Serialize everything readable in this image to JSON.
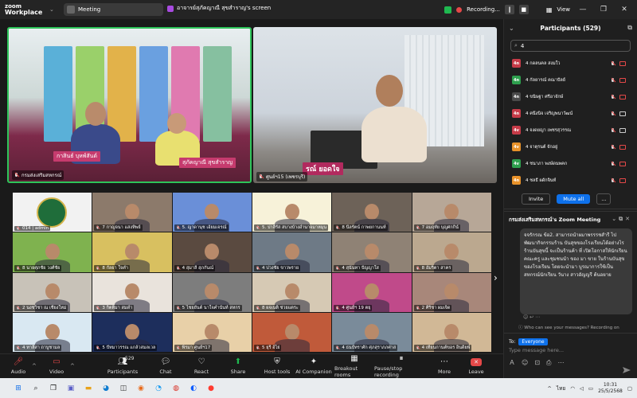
{
  "app": {
    "logo_line1": "zoom",
    "logo_line2": "Workplace",
    "meeting_label": "Meeting",
    "screen_share_label": "อาจารย์สุภัคญาณี สุขสำราญ's screen",
    "recording_label": "Recording...",
    "view_label": "View"
  },
  "spotlight": [
    {
      "name": "กรมส่งเสริมสหกรณ์",
      "nameplate_left": "กาสินธ์ บุหพ์สันต์",
      "nameplate_right": "สุภัคญาณี สุขสำราญ"
    },
    {
      "name": "ศูนย์ฯ15 (เพชรบุรี)",
      "nameplate_left": "รณ์ ยอดใจ"
    }
  ],
  "gallery": [
    {
      "name": "014 | admin",
      "color": "#f2f2f2"
    },
    {
      "name": "7 กาญจนา แสงทิพย์",
      "color": "#8c7a6b"
    },
    {
      "name": "5. ญาดานุช เอ้ยมเจรณ์",
      "color": "#6a8fd8"
    },
    {
      "name": "5. ปาลีรัส สบางบ้างอำนาจมาหมุน",
      "color": "#f7f2d9"
    },
    {
      "name": "8 นีลรัตน์ กาพยกานนท์",
      "color": "#6d6258"
    },
    {
      "name": "7 อมฤทัย บุญศกกิน์",
      "color": "#b7a797"
    },
    {
      "name": "8 นายศุภชัย วงศ์ชัย",
      "color": "#7fb24f"
    },
    {
      "name": "8 กัลยา ใจคำ",
      "color": "#d8c060"
    },
    {
      "name": "4 สุมาลี สุภกันณ์",
      "color": "#5a4a40"
    },
    {
      "name": "4 ปวงชัย ขาวพราย",
      "color": "#6e7a86"
    },
    {
      "name": "4 สุนันทา ปัญญาใส",
      "color": "#8f8275"
    },
    {
      "name": "8 อัมริตา สาคร",
      "color": "#bba88f"
    },
    {
      "name": "2 นงชวิชา ณ เชียงใหม่",
      "color": "#c8c2b8"
    },
    {
      "name": "3 กิตติมา สมดำ",
      "color": "#e9e3dc"
    },
    {
      "name": "5 ไชยยันต์ นาใจคำนันท์ สหกร",
      "color": "#7d7d7d"
    },
    {
      "name": "8 ผจเนติ ช่วยแตระ",
      "color": "#d6c9b4"
    },
    {
      "name": "4 ศูนย์ฯ 19 ตยุ",
      "color": "#c04a8a"
    },
    {
      "name": "2 ศิริชา ผมเจิด",
      "color": "#a8877a"
    },
    {
      "name": "4 ทาลีสา ถาบูชามล",
      "color": "#d9e8f2"
    },
    {
      "name": "5 ปัทมาวรรณ แกล้วสมลเวล",
      "color": "#1d2e5c"
    },
    {
      "name": "พิรมา ศูนย์ฯ17",
      "color": "#e8d0a8"
    },
    {
      "name": "5 ยุรี อ้ไย่",
      "color": "#c05a3a"
    },
    {
      "name": "4 ธนบัทราศัก ศุภสุราภภศาส",
      "color": "#7a8b9a"
    },
    {
      "name": "4 เทียนกานต์ขอร อินดิยพ์",
      "color": "#d1b896"
    }
  ],
  "toolbar": {
    "audio": "Audio",
    "video": "Video",
    "participants": "Participants",
    "participants_count": "529",
    "chat": "Chat",
    "react": "React",
    "share": "Share",
    "host_tools": "Host tools",
    "ai_companion": "AI Companion",
    "breakout": "Breakout rooms",
    "pause_rec": "Pause/stop recording",
    "more": "More",
    "leave": "Leave"
  },
  "participants": {
    "title": "Participants (529)",
    "search_value": "4",
    "list": [
      {
        "avatar": "4n",
        "name": "4 กดลนคล สงมใว",
        "color": "#c63b48",
        "cam": "off"
      },
      {
        "avatar": "4n",
        "name": "4 กัลยารณ์ คณาปัลย์",
        "color": "#2ea04e",
        "cam": "off"
      },
      {
        "avatar": "4n",
        "name": "4 ขนิษฐา ศรีอาจักษ์",
        "color": "#4a4a4a",
        "cam": "off"
      },
      {
        "avatar": "4n",
        "name": "4 คนึงนิจ เจริญพนาวัฒน์",
        "color": "#c63b48",
        "cam": "on"
      },
      {
        "avatar": "4v",
        "name": "4 จงดยญา เพชรสุวรรณ",
        "color": "#c63b48",
        "cam": "on"
      },
      {
        "avatar": "4v",
        "name": "4 จาตุรนต์ จักอยู่",
        "color": "#e8922a",
        "cam": "off"
      },
      {
        "avatar": "4v",
        "name": "4 ชนาภา พงษ์ดนพคก",
        "color": "#2ea04e",
        "cam": "off"
      },
      {
        "avatar": "4n",
        "name": "4 ชลธี ผดักจินท์",
        "color": "#e8922a",
        "cam": "off"
      }
    ],
    "invite": "Invite",
    "mute_all": "Mute all",
    "more": "..."
  },
  "chat": {
    "title": "กรมส่งเสริมสหกรณ์'s Zoom Meeting",
    "message": "จจรักรณ ข้อ2. สามารถนำผมาพรรรชสำรี ไปพัฒนากิจกรรมร้าน บันสุขของโรงเรียนได้อย่างไร ร้านบันสุขนี้ จะเป็นร้านค้า ที่ เปิดโอกาสให้นักเรียน คณะครู และชุมชนนำ ของ มา ขาย ในร้านบันสุข ของโรงเรียน โดยจะนำมา บูรณาการใช้เป็นสหกรณ์นักเรียน วันาง สาวอัญญรี ต้นอยาย",
    "who_can_see": "Who can see your messages? Recording on",
    "to_label": "To:",
    "to_value": "Everyone",
    "placeholder": "Type message here..."
  },
  "taskbar": {
    "search_placeholder": "",
    "lang": "ไทย",
    "time": "10:31",
    "date": "25/5/2568"
  }
}
